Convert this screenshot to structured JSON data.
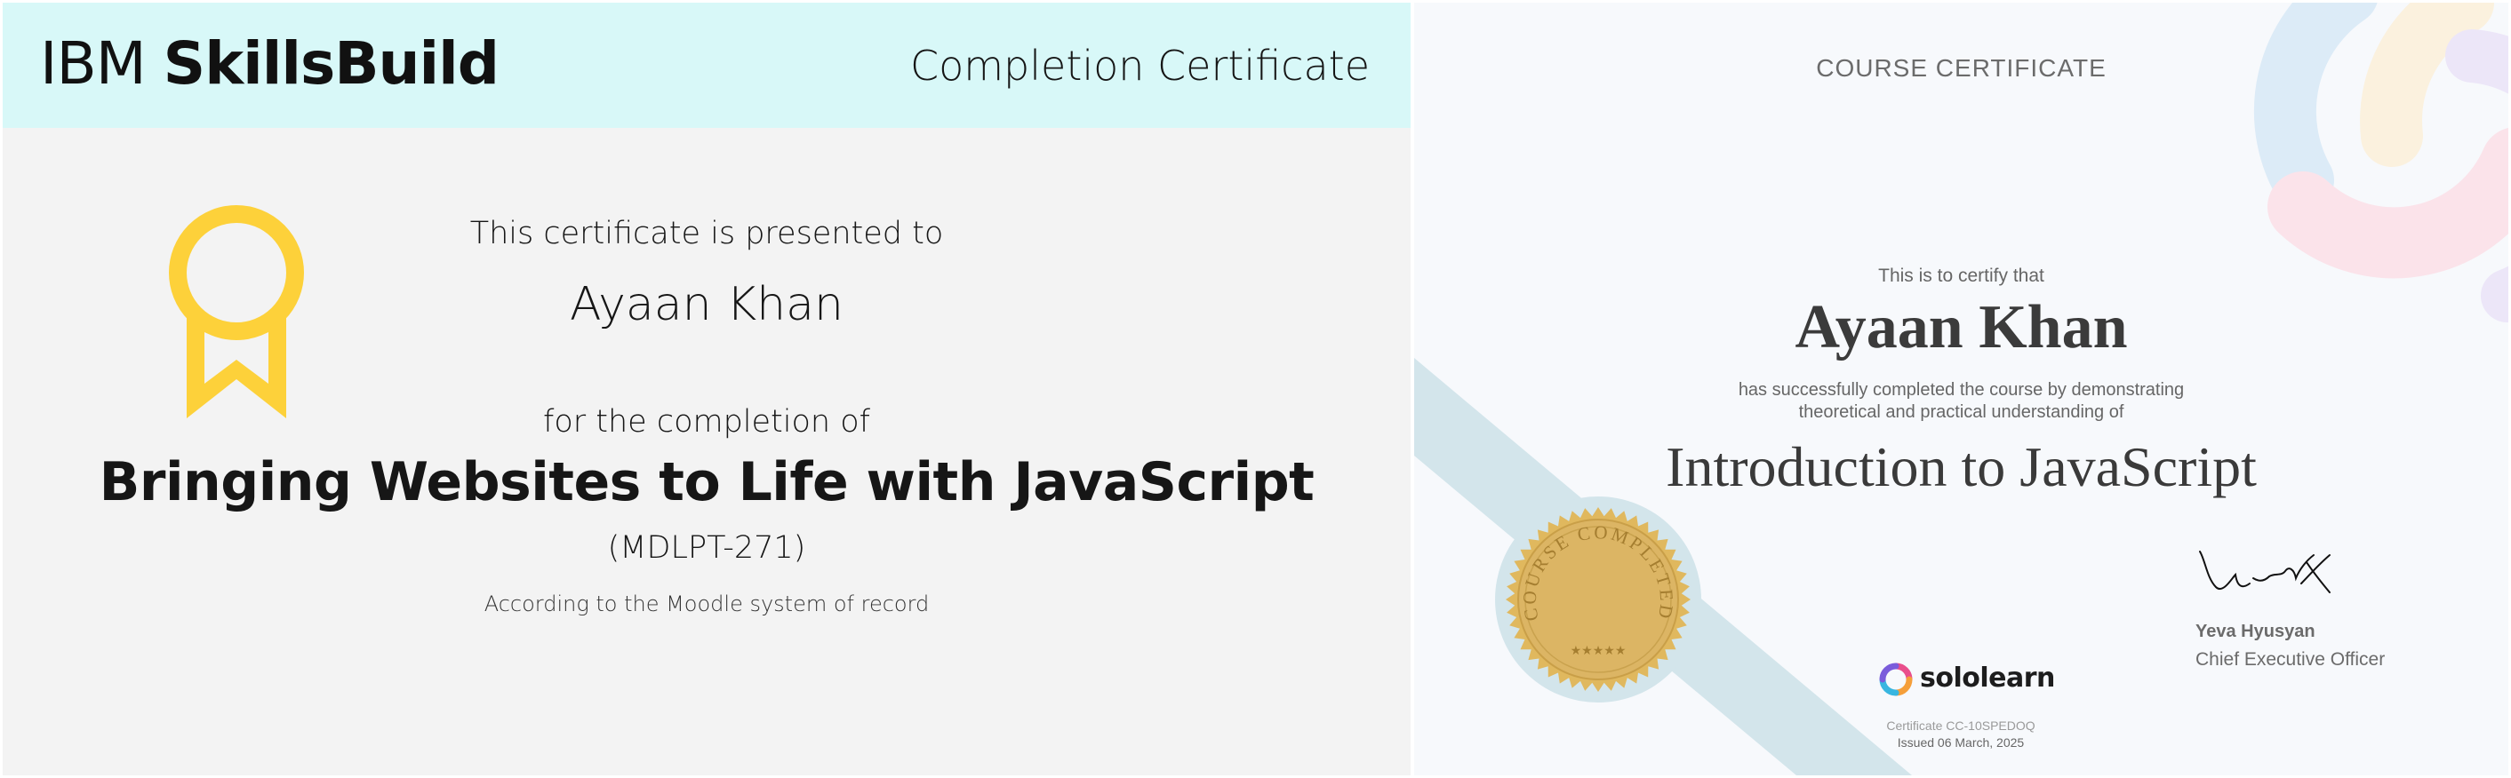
{
  "ibm_certificate": {
    "brand_light": "IBM ",
    "brand_bold": "SkillsBuild",
    "header_title": "Completion Certificate",
    "presented_to": "This certificate is presented to",
    "recipient": "Ayaan Khan",
    "completion_of": "for the completion of",
    "course_title": "Bringing Websites to Life with JavaScript",
    "course_code": "(MDLPT-271)",
    "record_note": "According to the Moodle system of record",
    "badge_icon": "ribbon-award-icon",
    "colors": {
      "header_bg": "#d8f8f8",
      "body_bg": "#f3f3f3",
      "badge": "#fdd13a"
    }
  },
  "sololearn_certificate": {
    "header": "COURSE CERTIFICATE",
    "certify": "This is to certify that",
    "recipient": "Ayaan Khan",
    "description_line1": "has successfully completed the course by demonstrating",
    "description_line2": "theoretical and practical understanding of",
    "course_title": "Introduction to JavaScript",
    "seal": {
      "text": "COURSE COMPLETED",
      "stars": "★★★★★",
      "icon": "gold-seal-icon"
    },
    "logo_text": "sololearn",
    "logo_icon": "sololearn-logo-icon",
    "certificate_id": "Certificate CC-10SPEDOQ",
    "issued": "Issued 06 March, 2025",
    "signer_name": "Yeva Hyusyan",
    "signer_role": "Chief Executive Officer",
    "signature_icon": "signature-icon",
    "colors": {
      "bg": "#f7f9fc",
      "band": "#d3e5eb",
      "seal": "#d9b25a"
    }
  }
}
